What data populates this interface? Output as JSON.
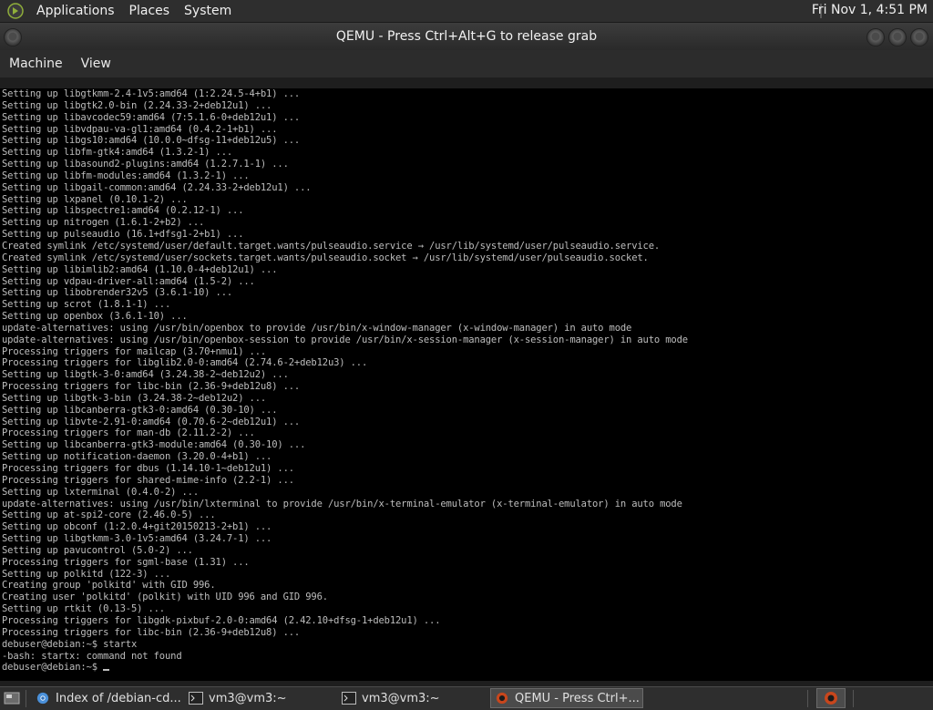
{
  "top_panel": {
    "menus": [
      "Applications",
      "Places",
      "System"
    ],
    "clock": "Fri Nov  1,  4:51 PM"
  },
  "window": {
    "title": "QEMU - Press Ctrl+Alt+G to release grab",
    "menu": [
      "Machine",
      "View"
    ]
  },
  "terminal": {
    "lines": [
      "Setting up libgtkmm-2.4-1v5:amd64 (1:2.24.5-4+b1) ...",
      "Setting up libgtk2.0-bin (2.24.33-2+deb12u1) ...",
      "Setting up libavcodec59:amd64 (7:5.1.6-0+deb12u1) ...",
      "Setting up libvdpau-va-gl1:amd64 (0.4.2-1+b1) ...",
      "Setting up libgs10:amd64 (10.0.0~dfsg-11+deb12u5) ...",
      "Setting up libfm-gtk4:amd64 (1.3.2-1) ...",
      "Setting up libasound2-plugins:amd64 (1.2.7.1-1) ...",
      "Setting up libfm-modules:amd64 (1.3.2-1) ...",
      "Setting up libgail-common:amd64 (2.24.33-2+deb12u1) ...",
      "Setting up lxpanel (0.10.1-2) ...",
      "Setting up libspectre1:amd64 (0.2.12-1) ...",
      "Setting up nitrogen (1.6.1-2+b2) ...",
      "Setting up pulseaudio (16.1+dfsg1-2+b1) ...",
      "Created symlink /etc/systemd/user/default.target.wants/pulseaudio.service → /usr/lib/systemd/user/pulseaudio.service.",
      "Created symlink /etc/systemd/user/sockets.target.wants/pulseaudio.socket → /usr/lib/systemd/user/pulseaudio.socket.",
      "Setting up libimlib2:amd64 (1.10.0-4+deb12u1) ...",
      "Setting up vdpau-driver-all:amd64 (1.5-2) ...",
      "Setting up libobrender32v5 (3.6.1-10) ...",
      "Setting up scrot (1.8.1-1) ...",
      "Setting up openbox (3.6.1-10) ...",
      "update-alternatives: using /usr/bin/openbox to provide /usr/bin/x-window-manager (x-window-manager) in auto mode",
      "update-alternatives: using /usr/bin/openbox-session to provide /usr/bin/x-session-manager (x-session-manager) in auto mode",
      "Processing triggers for mailcap (3.70+nmu1) ...",
      "Processing triggers for libglib2.0-0:amd64 (2.74.6-2+deb12u3) ...",
      "Setting up libgtk-3-0:amd64 (3.24.38-2~deb12u2) ...",
      "Processing triggers for libc-bin (2.36-9+deb12u8) ...",
      "Setting up libgtk-3-bin (3.24.38-2~deb12u2) ...",
      "Setting up libcanberra-gtk3-0:amd64 (0.30-10) ...",
      "Setting up libvte-2.91-0:amd64 (0.70.6-2~deb12u1) ...",
      "Processing triggers for man-db (2.11.2-2) ...",
      "Setting up libcanberra-gtk3-module:amd64 (0.30-10) ...",
      "Setting up notification-daemon (3.20.0-4+b1) ...",
      "Processing triggers for dbus (1.14.10-1~deb12u1) ...",
      "Processing triggers for shared-mime-info (2.2-1) ...",
      "Setting up lxterminal (0.4.0-2) ...",
      "update-alternatives: using /usr/bin/lxterminal to provide /usr/bin/x-terminal-emulator (x-terminal-emulator) in auto mode",
      "Setting up at-spi2-core (2.46.0-5) ...",
      "Setting up obconf (1:2.0.4+git20150213-2+b1) ...",
      "Setting up libgtkmm-3.0-1v5:amd64 (3.24.7-1) ...",
      "Setting up pavucontrol (5.0-2) ...",
      "Processing triggers for sgml-base (1.31) ...",
      "Setting up polkitd (122-3) ...",
      "Creating group 'polkitd' with GID 996.",
      "Creating user 'polkitd' (polkit) with UID 996 and GID 996.",
      "Setting up rtkit (0.13-5) ...",
      "Processing triggers for libgdk-pixbuf-2.0-0:amd64 (2.42.10+dfsg-1+deb12u1) ...",
      "Processing triggers for libc-bin (2.36-9+deb12u8) ...",
      "debuser@debian:~$ startx",
      "-bash: startx: command not found",
      "debuser@debian:~$ "
    ]
  },
  "taskbar": {
    "items": [
      {
        "label": "Index of /debian-cd...",
        "icon": "chromium-icon"
      },
      {
        "label": "vm3@vm3:~",
        "icon": "terminal-icon"
      },
      {
        "label": "vm3@vm3:~",
        "icon": "terminal-icon"
      },
      {
        "label": "QEMU - Press Ctrl+...",
        "icon": "qemu-icon"
      }
    ]
  }
}
